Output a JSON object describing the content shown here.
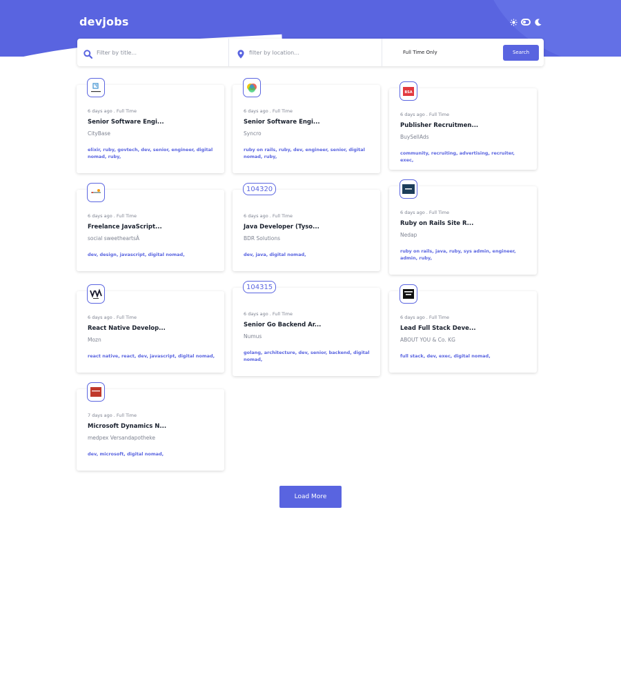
{
  "header": {
    "logo": "devjobs"
  },
  "search": {
    "title_placeholder": "Filter by title...",
    "location_placeholder": "filter by location...",
    "fulltime_label": "Full Time Only",
    "button_label": "Search"
  },
  "jobs": [
    {
      "posted": "6 days ago . Full Time",
      "title": "Senior Software Engi...",
      "company": "CityBase",
      "tags": "elixir, ruby, govtech, dev, senior, engineer, digital nomad, ruby,"
    },
    {
      "posted": "6 days ago . Full Time",
      "title": "Senior Software Engi...",
      "company": "Syncro",
      "tags": "ruby on rails, ruby, dev, engineer, senior, digital nomad, ruby,"
    },
    {
      "posted": "6 days ago . Full Time",
      "title": "Publisher Recruitmen...",
      "company": "BuySellAds",
      "tags": "community, recruiting, advertising, recruiter, exec,"
    },
    {
      "posted": "6 days ago . Full Time",
      "title": "Freelance JavaScript...",
      "company": "social sweetheartsÂ",
      "tags": "dev, design, javascript, digital nomad,"
    },
    {
      "posted": "6 days ago . Full Time",
      "title": "Java Developer (Tyso...",
      "company": "BDR Solutions",
      "tags": "dev, java, digital nomad,",
      "logo_text": "104320"
    },
    {
      "posted": "6 days ago . Full Time",
      "title": "Ruby on Rails Site R...",
      "company": "Nedap",
      "tags": "ruby on rails, java, ruby, sys admin, engineer, admin, ruby,"
    },
    {
      "posted": "6 days ago . Full Time",
      "title": "React Native Develop...",
      "company": "Mozn",
      "tags": "react native, react, dev, javascript, digital nomad,"
    },
    {
      "posted": "6 days ago . Full Time",
      "title": "Senior Go Backend Ar...",
      "company": "Numus",
      "tags": "golang, architecture, dev, senior, backend, digital nomad,",
      "logo_text": "104315"
    },
    {
      "posted": "6 days ago . Full Time",
      "title": "Lead Full Stack Deve...",
      "company": "ABOUT YOU & Co. KG",
      "tags": "full stack, dev, exec, digital nomad,"
    },
    {
      "posted": "7 days ago . Full Time",
      "title": "Microsoft Dynamics N...",
      "company": "medpex Versandapotheke",
      "tags": "dev, microsoft, digital nomad,"
    }
  ],
  "load_more_label": "Load More",
  "colors": {
    "accent": "#5964e0",
    "title": "#19202d",
    "muted": "#7d8290"
  }
}
